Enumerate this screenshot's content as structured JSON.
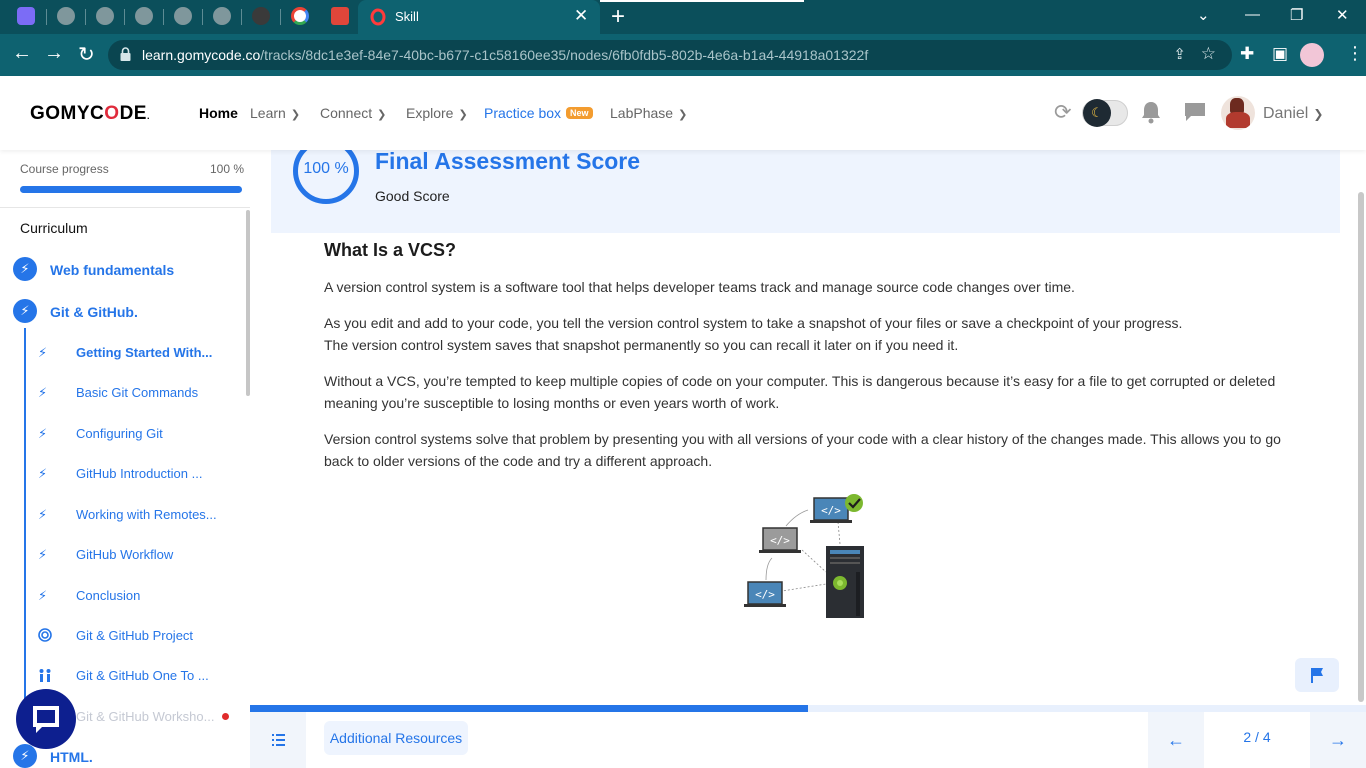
{
  "browser": {
    "tab_title": "Skill",
    "url_host": "learn.gomycode.co",
    "url_path": "/tracks/8dc1e3ef-84e7-40bc-b677-c1c58160ee35/nodes/6fb0fdb5-802b-4e6a-b1a4-44918a01322f"
  },
  "header": {
    "logo": "GOMYCODE",
    "nav": {
      "home": "Home",
      "learn": "Learn",
      "connect": "Connect",
      "explore": "Explore",
      "practice": "Practice box",
      "practice_badge": "New",
      "labphase": "LabPhase"
    },
    "user_name": "Daniel"
  },
  "sidebar": {
    "progress_label": "Course progress",
    "progress_value": "100 %",
    "progress_fraction": 1.0,
    "curriculum_title": "Curriculum",
    "chapters": [
      {
        "label": "Web fundamentals"
      },
      {
        "label": "Git & GitHub."
      },
      {
        "label": "HTML."
      }
    ],
    "lessons": [
      {
        "label": "Getting Started With...",
        "icon": "lightning-icon"
      },
      {
        "label": "Basic Git Commands",
        "icon": "lightning-icon"
      },
      {
        "label": "Configuring Git",
        "icon": "lightning-icon"
      },
      {
        "label": "GitHub Introduction ...",
        "icon": "lightning-icon"
      },
      {
        "label": "Working with Remotes...",
        "icon": "lightning-icon"
      },
      {
        "label": "GitHub Workflow",
        "icon": "lightning-icon"
      },
      {
        "label": "Conclusion",
        "icon": "lightning-icon"
      },
      {
        "label": "Git & GitHub Project",
        "icon": "target-icon"
      },
      {
        "label": "Git & GitHub One To ...",
        "icon": "people-icon"
      },
      {
        "label": "Git & GitHub Worksho...",
        "icon": "workshop-icon"
      }
    ]
  },
  "score": {
    "percent": "100 %",
    "title": "Final Assessment Score",
    "subtitle": "Good Score"
  },
  "article": {
    "heading": "What Is a VCS?",
    "p1": "A version control system is a software tool that helps developer teams track and manage source code changes over time.",
    "p2a": "As you edit and add to your code, you tell the version control system to take a snapshot of your files or save a checkpoint of your progress.",
    "p2b": "The version control system saves that snapshot permanently so you can recall it later on if you need it.",
    "p3": "Without a VCS, you’re tempted to keep multiple copies of code on your computer. This is dangerous because it’s easy for a file to get corrupted or deleted meaning you’re susceptible to losing months or even years worth of work.",
    "p4": "Version control systems solve that problem by presenting you with all versions of your code with a clear history of the changes made. This allows you to go back to older versions of the code and try a different approach.",
    "image_code_glyph": "</>"
  },
  "footer": {
    "resources_label": "Additional Resources",
    "page_indicator": "2 / 4",
    "progress_fraction": 0.5
  },
  "colors": {
    "brand_blue": "#2575e8",
    "browser_teal": "#0e6270",
    "logo_red": "#e02b3c",
    "badge_orange": "#f39c2f"
  }
}
